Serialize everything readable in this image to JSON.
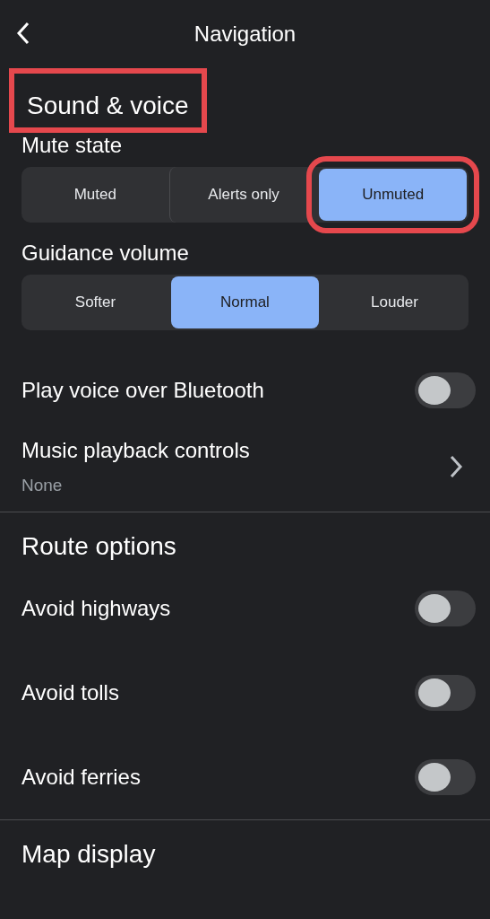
{
  "header": {
    "title": "Navigation"
  },
  "sections": [
    {
      "title": "Sound & voice",
      "highlighted": true,
      "items": [
        {
          "kind": "segmented",
          "label": "Mute state",
          "options": [
            {
              "label": "Muted",
              "selected": false,
              "highlighted": false
            },
            {
              "label": "Alerts only",
              "selected": false,
              "highlighted": false
            },
            {
              "label": "Unmuted",
              "selected": true,
              "highlighted": true
            }
          ]
        },
        {
          "kind": "segmented",
          "label": "Guidance volume",
          "options": [
            {
              "label": "Softer",
              "selected": false,
              "highlighted": false
            },
            {
              "label": "Normal",
              "selected": true,
              "highlighted": false
            },
            {
              "label": "Louder",
              "selected": false,
              "highlighted": false
            }
          ]
        },
        {
          "kind": "toggle",
          "label": "Play voice over Bluetooth",
          "on": false
        },
        {
          "kind": "link",
          "label": "Music playback controls",
          "value": "None"
        }
      ]
    },
    {
      "title": "Route options",
      "highlighted": false,
      "items": [
        {
          "kind": "toggle",
          "label": "Avoid highways",
          "on": false
        },
        {
          "kind": "toggle",
          "label": "Avoid tolls",
          "on": false
        },
        {
          "kind": "toggle",
          "label": "Avoid ferries",
          "on": false
        }
      ]
    },
    {
      "title": "Map display",
      "highlighted": false
    }
  ]
}
